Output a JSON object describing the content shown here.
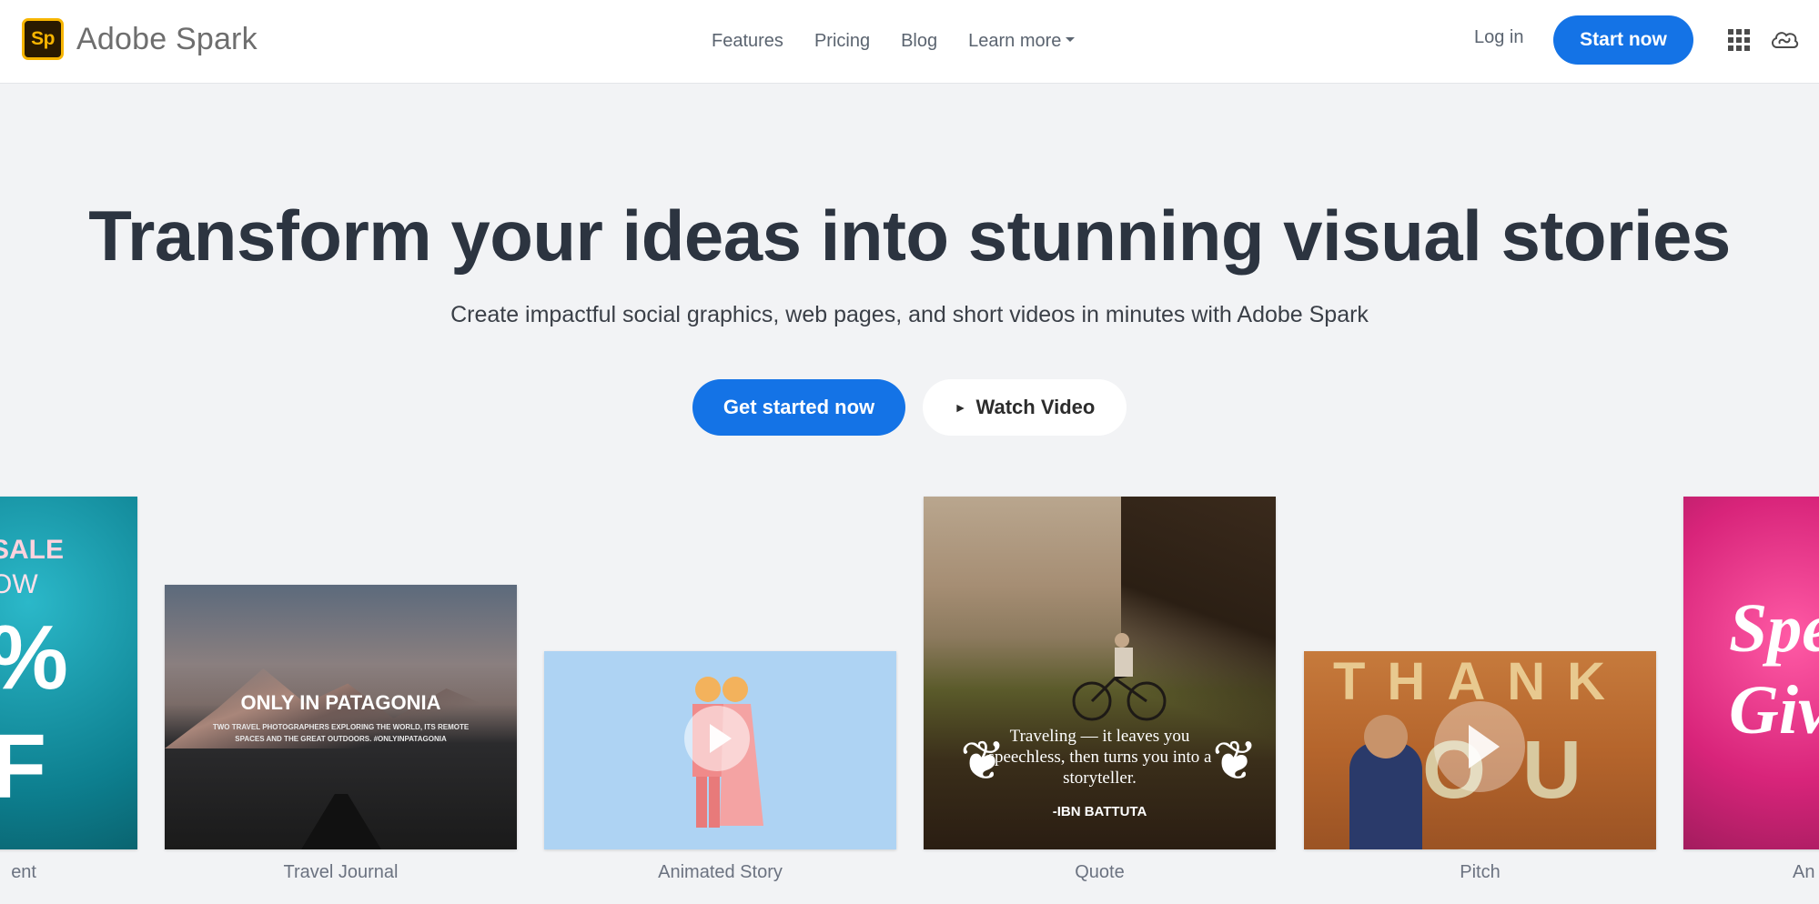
{
  "header": {
    "logo_text": "Sp",
    "brand_name": "Adobe Spark",
    "nav": [
      "Features",
      "Pricing",
      "Blog",
      "Learn more"
    ],
    "login": "Log in",
    "start_now": "Start now"
  },
  "hero": {
    "title": "Transform your ideas into stunning visual stories",
    "subtitle": "Create impactful social graphics, web pages, and short videos in minutes with Adobe Spark",
    "cta_primary": "Get started now",
    "cta_secondary": "Watch Video",
    "play_glyph": "►"
  },
  "cards": [
    {
      "label": "ent",
      "text": {
        "sale": "SALE",
        "now": "OW",
        "pct": "%",
        "ff": "F"
      }
    },
    {
      "label": "Travel Journal",
      "text": {
        "title": "ONLY IN PATAGONIA",
        "desc": "TWO TRAVEL PHOTOGRAPHERS EXPLORING THE WORLD, ITS REMOTE SPACES AND THE GREAT OUTDOORS. #ONLYINPATAGONIA"
      }
    },
    {
      "label": "Animated Story"
    },
    {
      "label": "Quote",
      "text": {
        "quote": "Traveling — it leaves you speechless, then turns you into a storyteller.",
        "author": "-IBN BATTUTA"
      }
    },
    {
      "label": "Pitch",
      "text": {
        "row1": "THANK",
        "row2": "OU"
      }
    },
    {
      "label": "An",
      "text": {
        "script": "Spe Giv"
      }
    }
  ],
  "colors": {
    "accent": "#1473e6",
    "logo_fill": "#2a1a00",
    "logo_border": "#f7b500"
  },
  "icons": [
    "apps-grid-icon",
    "creative-cloud-icon",
    "play-icon"
  ]
}
